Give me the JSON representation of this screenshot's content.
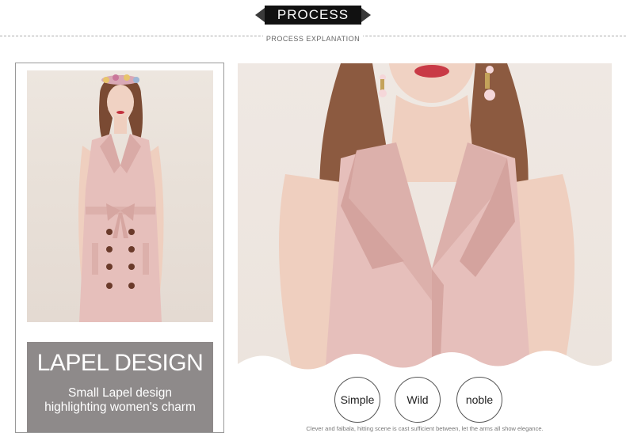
{
  "header": {
    "title": "PROCESS",
    "subtitle": "PROCESS EXPLANATION"
  },
  "left": {
    "photo_alt": "Model wearing a pink sleeveless lapel dress with belt and buttons",
    "caption": {
      "title": "LAPEL DESIGN",
      "line1": "Small Lapel design",
      "line2": "highlighting women's charm"
    }
  },
  "right": {
    "photo_alt": "Close-up of pink lapel collar",
    "tags": [
      "Simple",
      "Wild",
      "noble"
    ],
    "footnote": "Clever and falbala, hitting scene is cast sufficient between, let the arms all show elegance."
  },
  "colors": {
    "dress_pink": "#e6bfbb",
    "caption_gray": "#8e8a8a",
    "tag_black": "#111111"
  }
}
